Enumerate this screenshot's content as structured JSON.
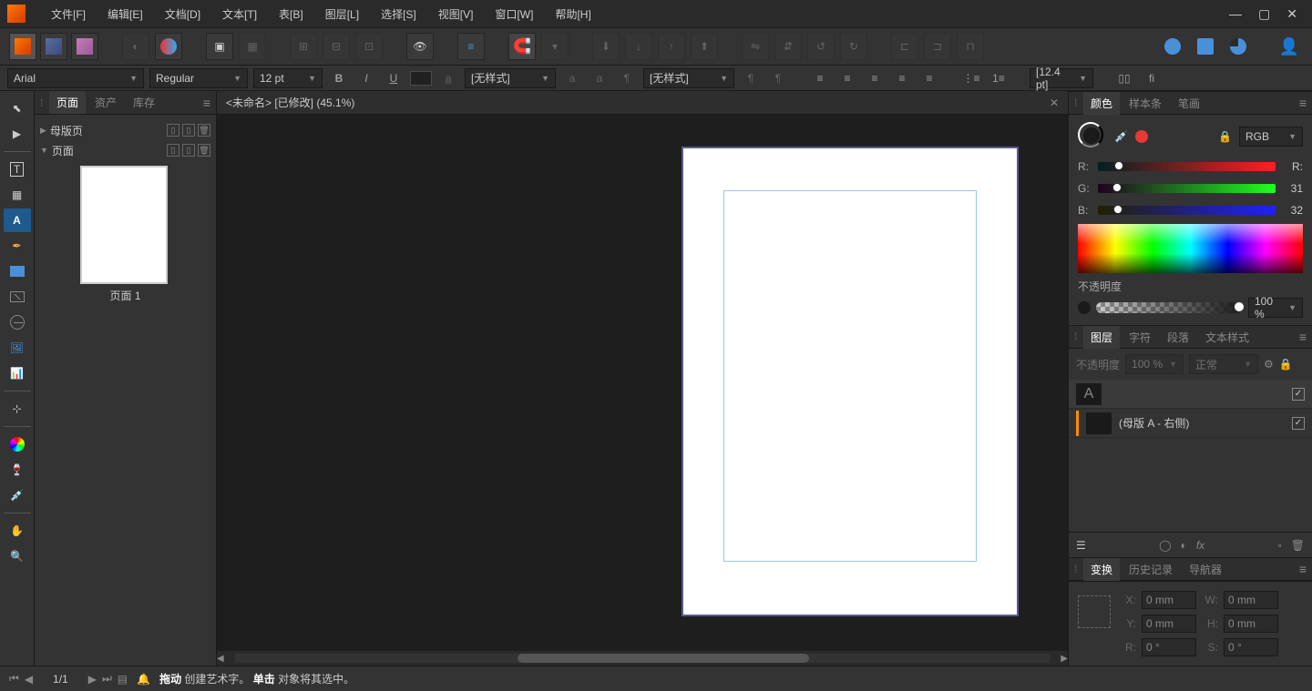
{
  "menu": {
    "file": "文件[F]",
    "edit": "编辑[E]",
    "doc": "文档[D]",
    "text": "文本[T]",
    "table": "表[B]",
    "layer": "图层[L]",
    "select": "选择[S]",
    "view": "视图[V]",
    "window": "窗口[W]",
    "help": "帮助[H]"
  },
  "optbar": {
    "font": "Arial",
    "weight": "Regular",
    "size": "12 pt",
    "charstyle": "[无样式]",
    "parastyle": "[无样式]",
    "leading": "[12.4 pt]"
  },
  "leftpanel": {
    "tabs": {
      "pages": "页面",
      "assets": "资产",
      "stock": "库存"
    },
    "master": "母版页",
    "pages": "页面",
    "page1": "页面 1"
  },
  "doctab": "<未命名> [已修改] (45.1%)",
  "rightpanel": {
    "colortabs": {
      "color": "颜色",
      "swatches": "样本条",
      "stroke": "笔画"
    },
    "colormode": "RGB",
    "r_label": "R:",
    "g_label": "G:",
    "b_label": "B:",
    "r": "R:",
    "g": "31",
    "b": "32",
    "opacity_label": "不透明度",
    "opacity": "100 %",
    "layertabs": {
      "layers": "图层",
      "char": "字符",
      "para": "段落",
      "textstyle": "文本样式"
    },
    "opac_label": "不透明度",
    "opac_val": "100 %",
    "blend": "正常",
    "layer_master": "(母版 A - 右侧)",
    "transformtabs": {
      "transform": "变换",
      "history": "历史记录",
      "navigator": "导航器"
    },
    "x": "X:",
    "y": "Y:",
    "w": "W:",
    "h": "H:",
    "s": "S:",
    "xv": "0 mm",
    "yv": "0 mm",
    "wv": "0 mm",
    "hv": "0 mm",
    "rv": "0 °",
    "sv": "0 °"
  },
  "status": {
    "page": "1/1",
    "hint_drag": "拖动",
    "hint_drag_txt": " 创建艺术字。",
    "hint_click": "单击",
    "hint_click_txt": " 对象将其选中。"
  }
}
